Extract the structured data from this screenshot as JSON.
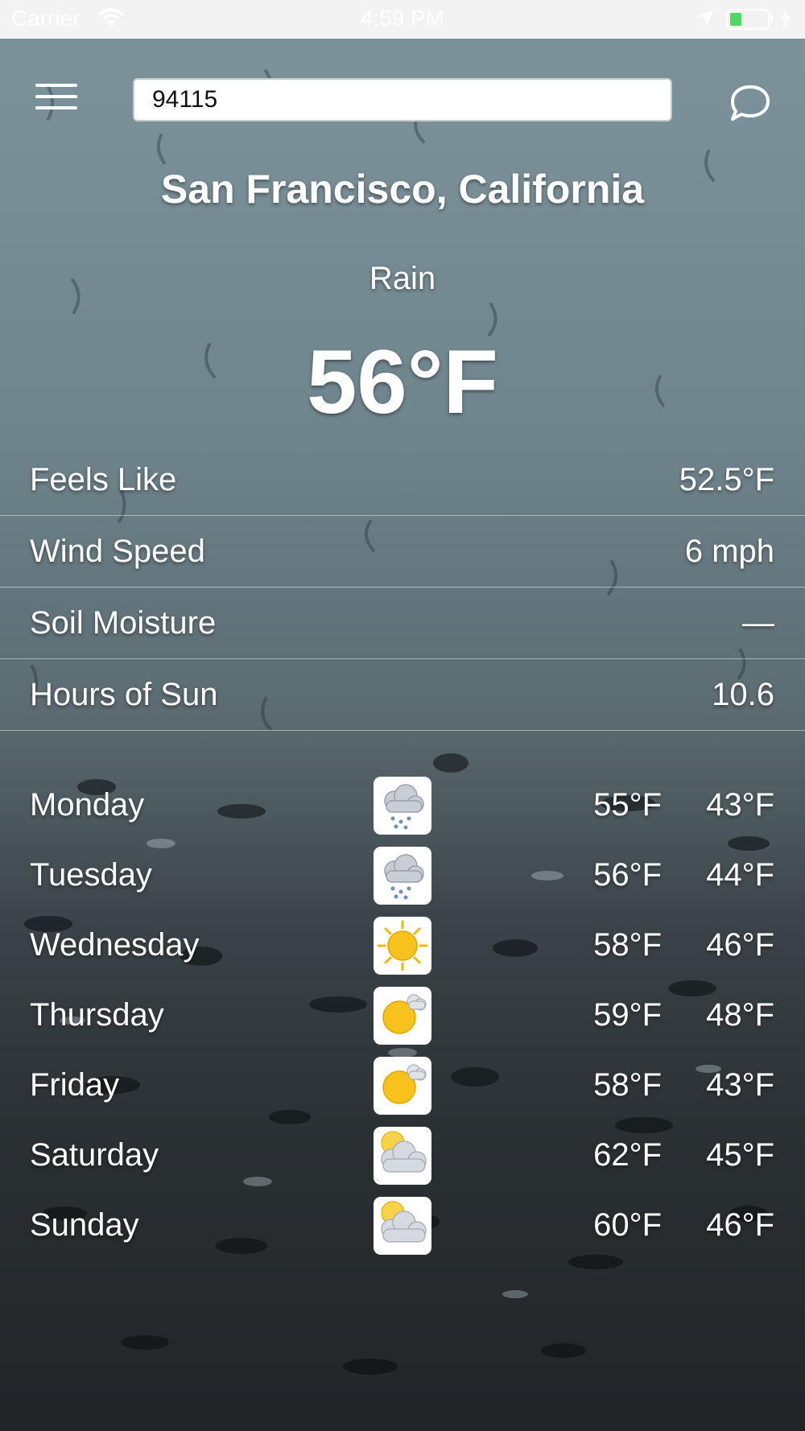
{
  "status_bar": {
    "carrier": "Carrier",
    "time": "4:59 PM",
    "battery_color": "#4cd964"
  },
  "header": {
    "search_value": "94115",
    "menu_icon": "hamburger-menu-icon",
    "chat_icon": "speech-bubble-icon"
  },
  "current": {
    "location": "San Francisco, California",
    "condition": "Rain",
    "temperature": "56°F"
  },
  "stats": [
    {
      "label": "Feels Like",
      "value": "52.5°F"
    },
    {
      "label": "Wind Speed",
      "value": "6 mph"
    },
    {
      "label": "Soil Moisture",
      "value": "—"
    },
    {
      "label": "Hours of Sun",
      "value": "10.6"
    }
  ],
  "forecast": [
    {
      "day": "Monday",
      "icon": "rain-cloud-icon",
      "high": "55°F",
      "low": "43°F"
    },
    {
      "day": "Tuesday",
      "icon": "rain-cloud-icon",
      "high": "56°F",
      "low": "44°F"
    },
    {
      "day": "Wednesday",
      "icon": "sun-icon",
      "high": "58°F",
      "low": "46°F"
    },
    {
      "day": "Thursday",
      "icon": "partly-cloudy-icon",
      "high": "59°F",
      "low": "48°F"
    },
    {
      "day": "Friday",
      "icon": "partly-cloudy-icon",
      "high": "58°F",
      "low": "43°F"
    },
    {
      "day": "Saturday",
      "icon": "mostly-cloudy-icon",
      "high": "62°F",
      "low": "45°F"
    },
    {
      "day": "Sunday",
      "icon": "mostly-cloudy-icon",
      "high": "60°F",
      "low": "46°F"
    }
  ]
}
